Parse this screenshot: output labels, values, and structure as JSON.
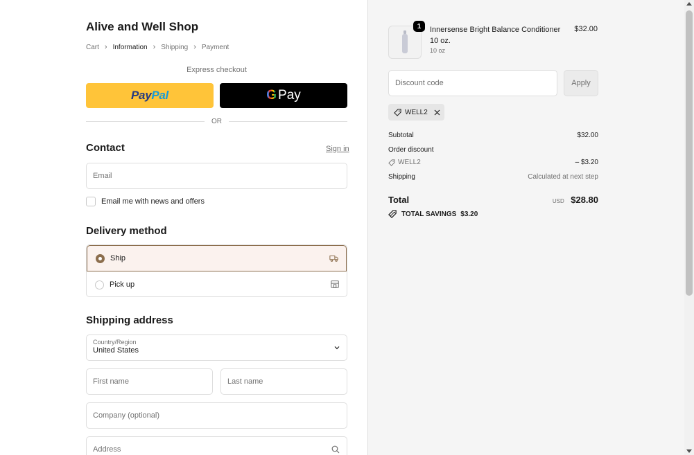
{
  "shop": {
    "title": "Alive and Well Shop"
  },
  "breadcrumb": [
    {
      "label": "Cart",
      "current": false
    },
    {
      "label": "Information",
      "current": true
    },
    {
      "label": "Shipping",
      "current": false
    },
    {
      "label": "Payment",
      "current": false
    }
  ],
  "express": {
    "label": "Express checkout",
    "paypal_a": "Pay",
    "paypal_b": "Pal",
    "gpay_g": "G",
    "gpay_text": "Pay",
    "or_text": "OR"
  },
  "contact": {
    "heading": "Contact",
    "signin": "Sign in",
    "email_placeholder": "Email",
    "newsletter_label": "Email me with news and offers"
  },
  "delivery": {
    "heading": "Delivery method",
    "options": [
      {
        "label": "Ship",
        "selected": true,
        "icon": "truck-icon"
      },
      {
        "label": "Pick up",
        "selected": false,
        "icon": "store-icon"
      }
    ]
  },
  "shipping": {
    "heading": "Shipping address",
    "country_label": "Country/Region",
    "country_value": "United States",
    "first_name_placeholder": "First name",
    "last_name_placeholder": "Last name",
    "company_placeholder": "Company (optional)",
    "address_placeholder": "Address"
  },
  "order": {
    "item": {
      "name": "Innersense Bright Balance Conditioner 10 oz.",
      "variant": "10 oz",
      "price": "$32.00",
      "quantity": "1"
    },
    "discount_placeholder": "Discount code",
    "apply_label": "Apply",
    "applied_code": "WELL2",
    "subtotal_label": "Subtotal",
    "subtotal_value": "$32.00",
    "order_discount_label": "Order discount",
    "discount_code_label": "WELL2",
    "discount_value": "– $3.20",
    "shipping_label": "Shipping",
    "shipping_value": "Calculated at next step",
    "total_label": "Total",
    "total_currency": "USD",
    "total_value": "$28.80",
    "savings_label": "TOTAL SAVINGS",
    "savings_value": "$3.20"
  },
  "colors": {
    "accent": "#8c6e4d",
    "selected_bg": "#fbf2ee",
    "paypal": "#ffc439",
    "gpay": "#000000"
  }
}
